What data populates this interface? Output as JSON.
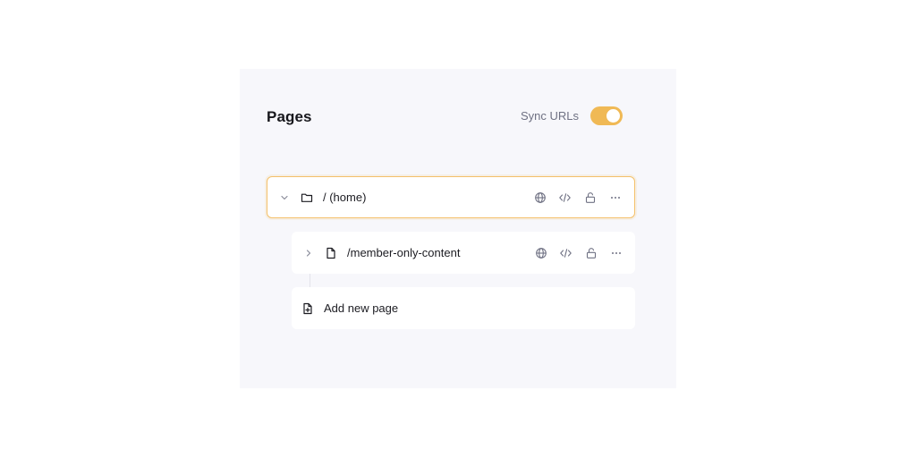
{
  "header": {
    "title": "Pages",
    "sync_label": "Sync URLs",
    "sync_enabled": true,
    "accent_color": "#f0b955"
  },
  "pages": [
    {
      "label": "/ (home)",
      "icon": "folder-icon",
      "expanded": true,
      "selected": true
    },
    {
      "label": "/member-only-content",
      "icon": "file-icon",
      "expanded": false,
      "selected": false
    }
  ],
  "row_actions": [
    "globe-icon",
    "code-icon",
    "lock-open-icon",
    "more-icon"
  ],
  "add_page": {
    "label": "Add new page",
    "icon": "file-plus-icon"
  }
}
